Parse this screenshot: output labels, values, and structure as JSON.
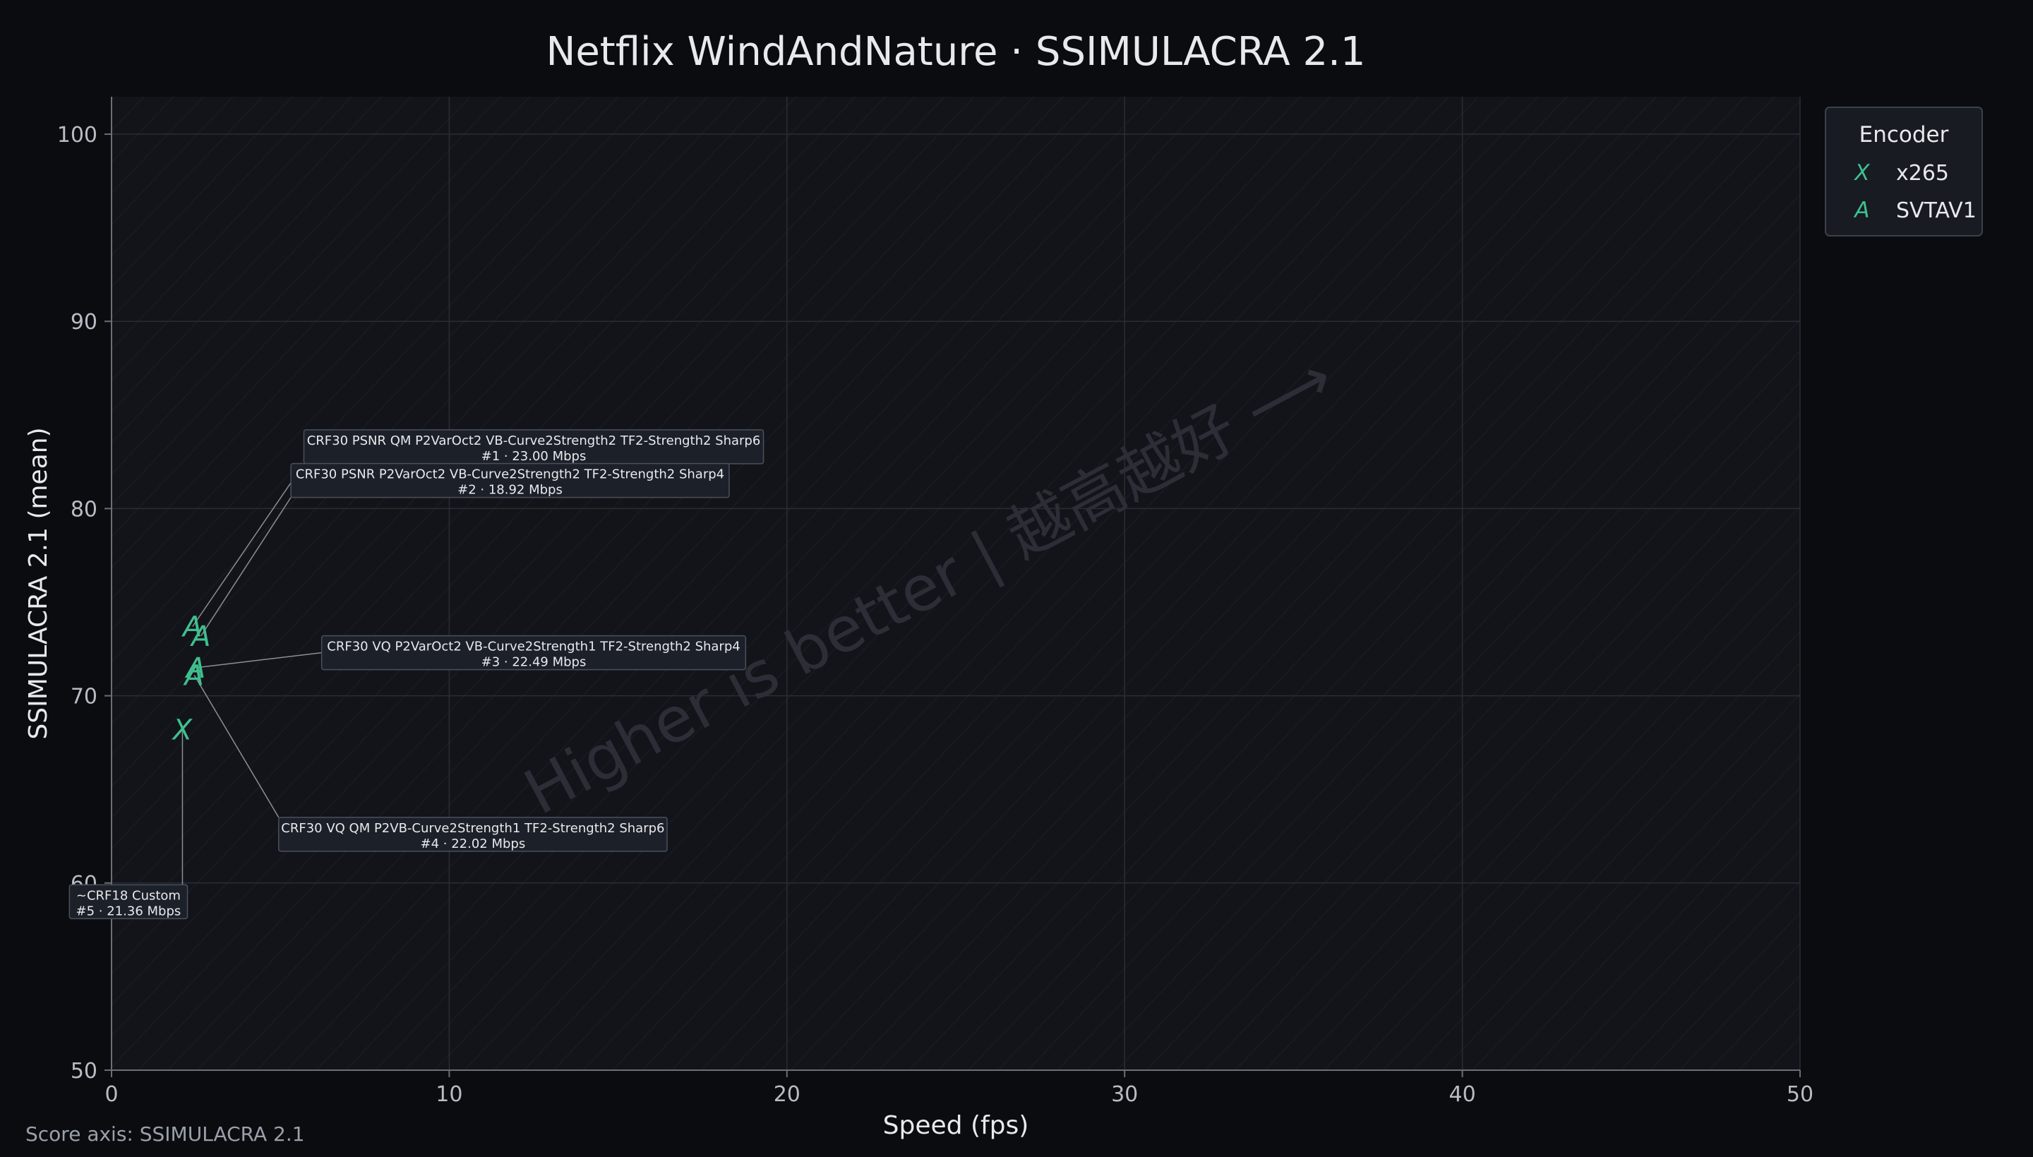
{
  "colors": {
    "page_bg": "#0b0c10",
    "plot_bg": "#131419",
    "grid": "#2a2d34",
    "axis": "#6a6f78",
    "text": "#e8e9ec",
    "tick_text": "#b8bcc4",
    "marker": "#3fbf8f",
    "annotation_bg": "#1c2029",
    "annotation_border": "#4a505c",
    "leader_line": "#8a8f98",
    "watermark": "#2b2e36",
    "legend_bg": "#181b22",
    "legend_border": "#3c414c"
  },
  "chart_data": {
    "type": "scatter",
    "title": "Netflix WindAndNature · SSIMULACRA 2.1",
    "xlabel": "Speed (fps)",
    "ylabel": "SSIMULACRA 2.1 (mean)",
    "xlim": [
      0,
      50
    ],
    "ylim": [
      50,
      102
    ],
    "xticks": [
      0,
      10,
      20,
      30,
      40,
      50
    ],
    "yticks": [
      50,
      60,
      70,
      80,
      90,
      100
    ],
    "grid": true,
    "legend": {
      "title": "Encoder",
      "placement": "outside-right-top",
      "entries": [
        {
          "marker": "X",
          "label": "x265"
        },
        {
          "marker": "A",
          "label": "SVTAV1"
        }
      ]
    },
    "series": [
      {
        "name": "x265",
        "marker": "X",
        "points": [
          {
            "x": 2.1,
            "y": 68.2,
            "label_line1": "~CRF18 Custom",
            "label_line2": "#5 · 21.36 Mbps",
            "label_x": 0.5,
            "label_y": 59.0
          }
        ]
      },
      {
        "name": "SVTAV1",
        "marker": "A",
        "points": [
          {
            "x": 2.4,
            "y": 73.7,
            "label_line1": "CRF30 PSNR QM P2VarOct2 VB-Curve2Strength2 TF2-Strength2 Sharp6",
            "label_line2": "#1 · 23.00 Mbps",
            "label_x": 12.5,
            "label_y": 83.3
          },
          {
            "x": 2.65,
            "y": 73.2,
            "label_line1": "CRF30 PSNR P2VarOct2 VB-Curve2Strength2 TF2-Strength2 Sharp4",
            "label_line2": "#2 · 18.92 Mbps",
            "label_x": 11.8,
            "label_y": 81.5
          },
          {
            "x": 2.5,
            "y": 71.5,
            "label_line1": "CRF30 VQ P2VarOct2 VB-Curve2Strength1 TF2-Strength2 Sharp4",
            "label_line2": "#3 · 22.49 Mbps",
            "label_x": 12.5,
            "label_y": 72.3
          },
          {
            "x": 2.45,
            "y": 71.1,
            "label_line1": "CRF30 VQ QM P2VB-Curve2Strength1 TF2-Strength2 Sharp6",
            "label_line2": "#4 · 22.02 Mbps",
            "label_x": 10.7,
            "label_y": 62.6
          }
        ]
      }
    ],
    "watermark": "Higher is better  |  越高越好  ⟶"
  },
  "footer_note": "Score axis: SSIMULACRA 2.1"
}
